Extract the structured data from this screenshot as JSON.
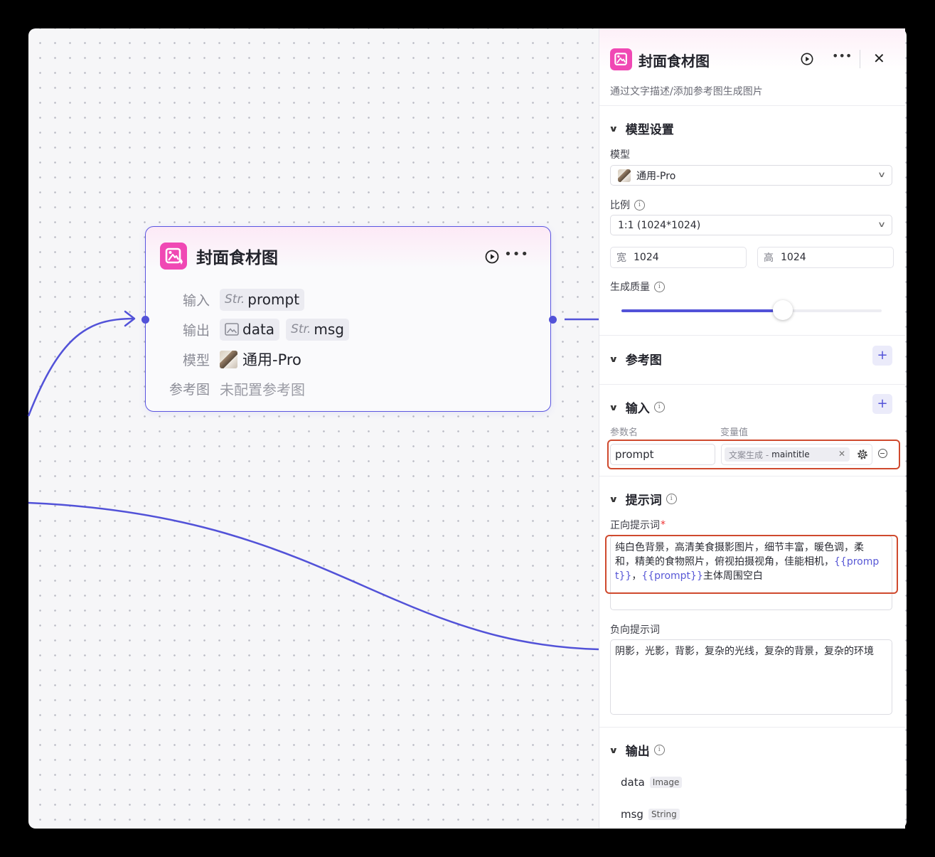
{
  "colors": {
    "accent": "#5252d8",
    "highlight": "#cf4a2e",
    "brand_pink": "#f048b4"
  },
  "node": {
    "title": "封面食材图",
    "rows": {
      "input": {
        "label": "输入",
        "type": "Str.",
        "name": "prompt"
      },
      "output": {
        "label": "输出",
        "items": [
          {
            "type_icon": "image-icon",
            "name": "data"
          },
          {
            "type": "Str.",
            "name": "msg"
          }
        ]
      },
      "model": {
        "label": "模型",
        "value": "通用-Pro"
      },
      "reference": {
        "label": "参考图",
        "value": "未配置参考图"
      }
    }
  },
  "panel": {
    "title": "封面食材图",
    "description": "通过文字描述/添加参考图生成图片",
    "model_settings": {
      "section": "模型设置",
      "model_label": "模型",
      "model_value": "通用-Pro",
      "ratio_label": "比例",
      "ratio_value": "1:1 (1024*1024)",
      "width_prefix": "宽",
      "width_value": "1024",
      "height_prefix": "高",
      "height_value": "1024",
      "quality_label": "生成质量",
      "quality_fraction": 0.62
    },
    "reference": {
      "section": "参考图"
    },
    "inputs": {
      "section": "输入",
      "col_name": "参数名",
      "col_value": "变量值",
      "row": {
        "name": "prompt",
        "source": "文案生成 -",
        "key": "maintitle"
      }
    },
    "prompt": {
      "section": "提示词",
      "positive_label": "正向提示词",
      "positive": {
        "text_1": "纯白色背景，高清美食摄影图片，细节丰富，暖色调，柔和，精美的食物照片，俯视拍摄视角，佳能相机，",
        "token_1": "{{prompt}}",
        "text_2": "，",
        "token_2": "{{prompt}}",
        "text_3": "主体周围空白"
      },
      "negative_label": "负向提示词",
      "negative": "阴影，光影，背影，复杂的光线，复杂的背景，复杂的环境"
    },
    "outputs": {
      "section": "输出",
      "items": [
        {
          "name": "data",
          "type": "Image"
        },
        {
          "name": "msg",
          "type": "String"
        }
      ]
    }
  }
}
